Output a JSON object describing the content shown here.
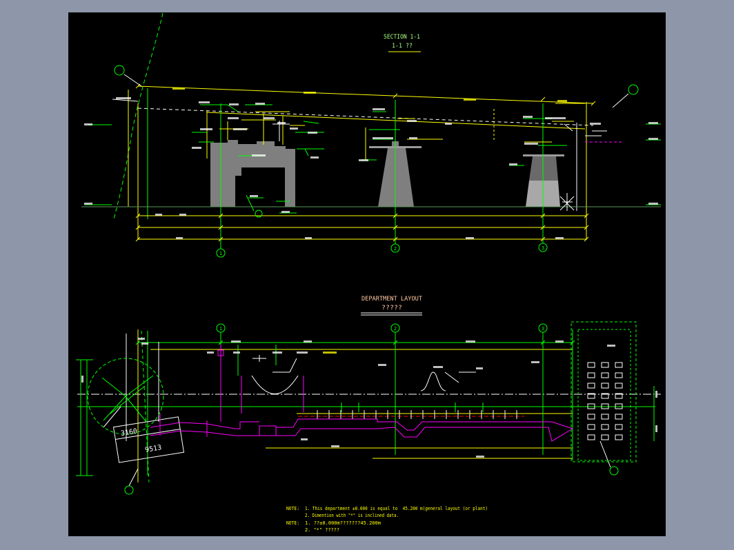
{
  "colors": {
    "window_background": "#8d97a9",
    "drawing_background": "#000000",
    "yellow": "#ffff00",
    "green": "#00ff00",
    "white": "#ffffff",
    "magenta": "#ff00ff",
    "red": "#ff0000",
    "ground": "#5a9a5a",
    "pier_gray": "#7f7f7f",
    "section_title": "#a8ff80",
    "layout_title": "#ffc8a0"
  },
  "section": {
    "title": "SECTION 1-1",
    "subtitle": "1-1 ??",
    "axis_labels": [
      "1",
      "2",
      "3"
    ]
  },
  "layout": {
    "title": "DEPARTMENT LAYOUT",
    "subtitle": "?????",
    "axis_labels": [
      "1",
      "2",
      "3"
    ],
    "dimensions": [
      "3160",
      "9513"
    ]
  },
  "notes": [
    {
      "label": "NOTE:",
      "lines": [
        "1. This department ±0.000 is equal to  45.200 m(general layout (or plant)",
        "2. Dimention with \"*\" is inclined data."
      ]
    },
    {
      "label": "NOTE:",
      "lines": [
        "1. ??±0.000m???????45.200m",
        "2. \"*\" ?????"
      ]
    }
  ]
}
